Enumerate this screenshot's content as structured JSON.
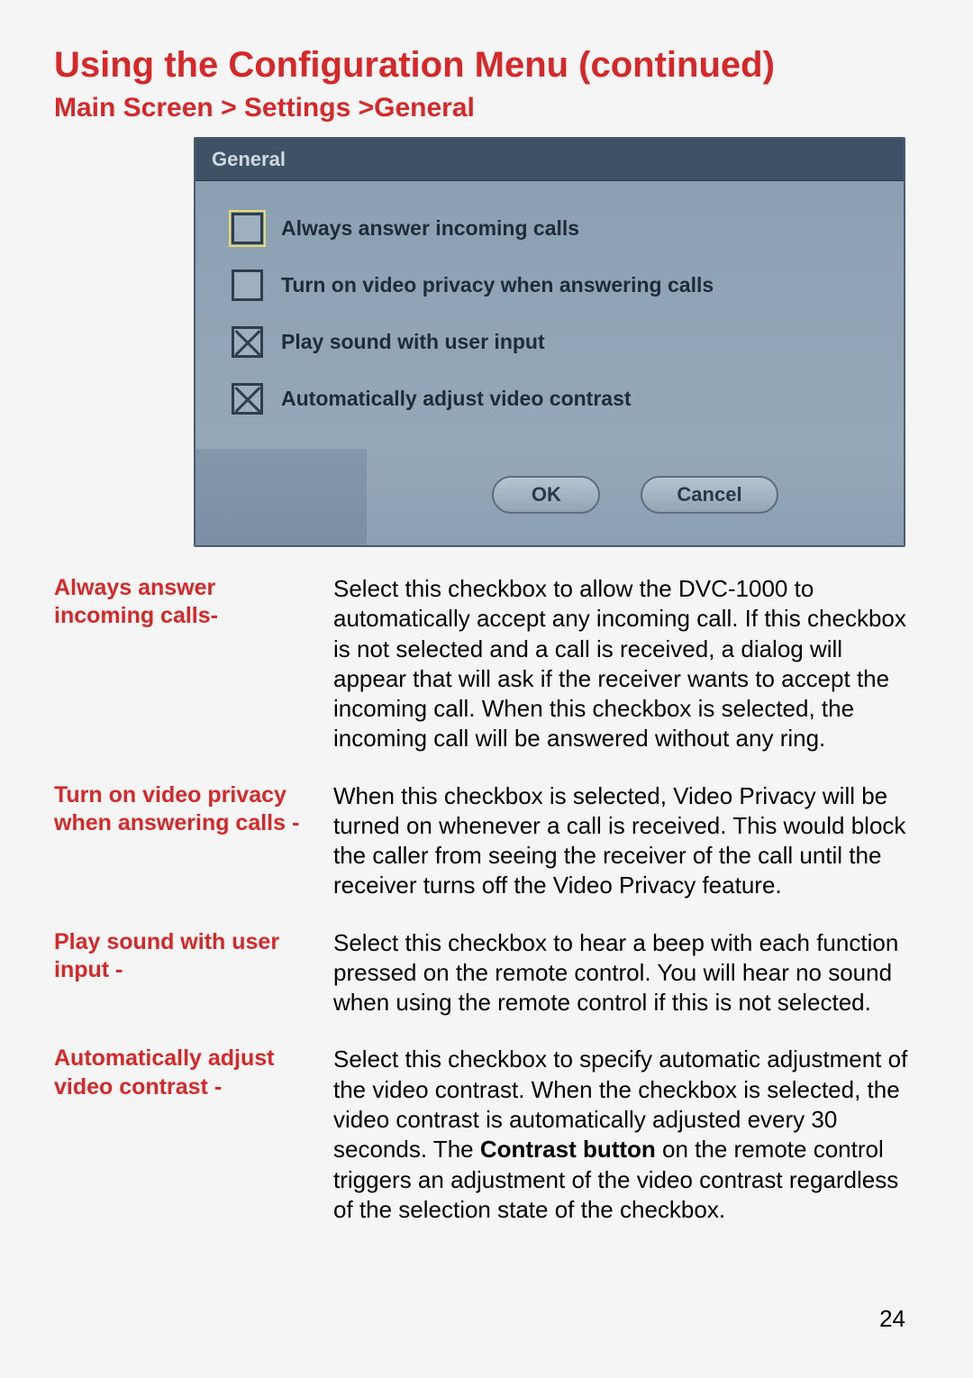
{
  "title": "Using the Configuration Menu (continued)",
  "breadcrumb": "Main Screen > Settings >General",
  "dialog": {
    "header": "General",
    "options": [
      {
        "label": "Always answer incoming calls",
        "checked": false,
        "selected": true
      },
      {
        "label": "Turn on video privacy when answering calls",
        "checked": false,
        "selected": false
      },
      {
        "label": "Play sound with user input",
        "checked": true,
        "selected": false
      },
      {
        "label": "Automatically adjust video contrast",
        "checked": true,
        "selected": false
      }
    ],
    "buttons": {
      "ok": "OK",
      "cancel": "Cancel"
    }
  },
  "descriptions": [
    {
      "label": "Always answer incoming calls-",
      "text": "Select this checkbox to allow the DVC-1000 to automatically accept any incoming call. If this checkbox is not selected and a call is received, a dialog will appear that will ask if the receiver wants to accept the incoming call. When this checkbox is selected, the incoming call will be answered without any ring."
    },
    {
      "label": "Turn on video privacy when answering calls -",
      "text": "When this checkbox is selected, Video Privacy will be turned on whenever a call is received. This would block the caller from seeing the receiver of the call until the receiver turns off the Video Privacy feature."
    },
    {
      "label": "Play sound with user input -",
      "text": "Select this checkbox to hear a beep with each function pressed on the remote control. You will hear no sound when using the remote control if this is not selected."
    },
    {
      "label": "Automatically adjust video contrast -",
      "text_pre": "Select this checkbox to specify automatic adjustment of the video contrast. When the checkbox is selected, the video contrast is automatically adjusted every 30 seconds. The ",
      "text_bold": "Contrast button",
      "text_post": " on the remote control triggers an adjustment of the video contrast regardless of the selection state of the checkbox."
    }
  ],
  "page_number": "24"
}
